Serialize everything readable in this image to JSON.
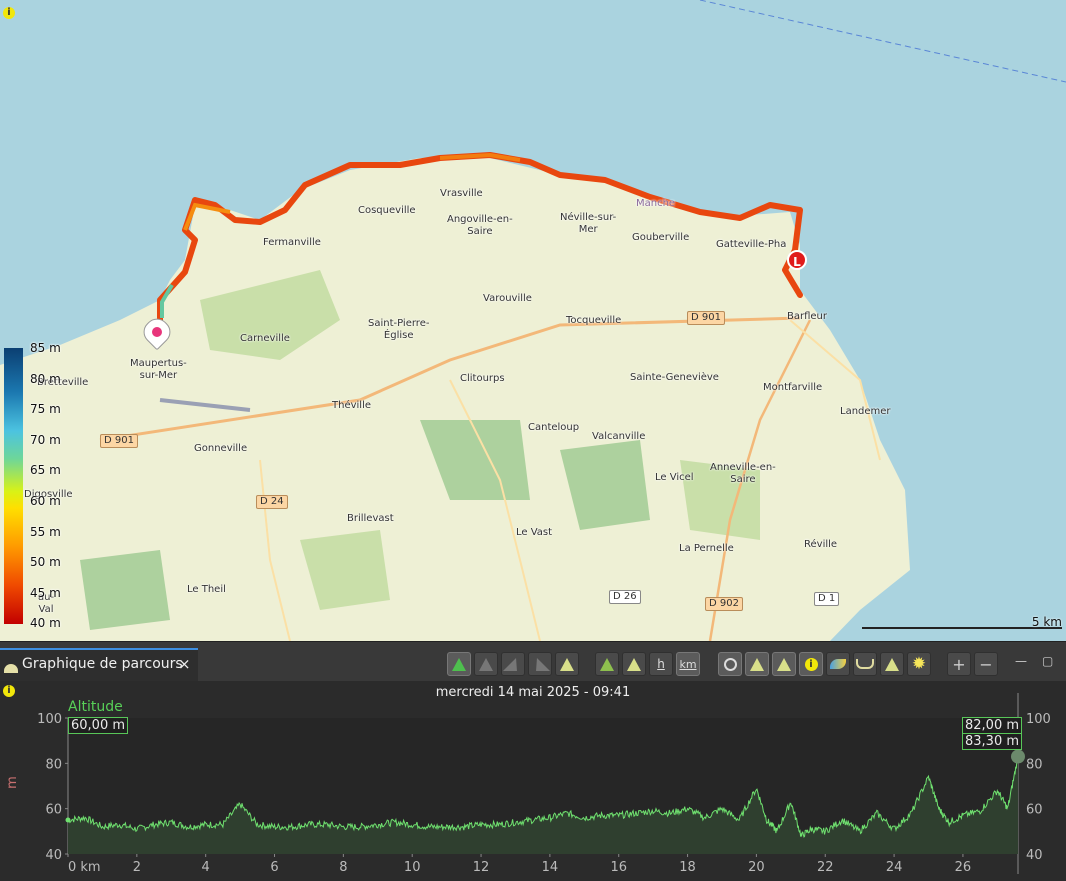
{
  "map": {
    "places": [
      {
        "name": "Vrasville"
      },
      {
        "name": "Cosqueville"
      },
      {
        "name": "Angoville-en-\nSaire"
      },
      {
        "name": "Néville-sur-\nMer"
      },
      {
        "name": "Gouberville"
      },
      {
        "name": "Gatteville-Pha"
      },
      {
        "name": "Fermanville"
      },
      {
        "name": "Varouville"
      },
      {
        "name": "Saint-Pierre-\nÉglise"
      },
      {
        "name": "Tocqueville"
      },
      {
        "name": "Barfleur"
      },
      {
        "name": "Carneville"
      },
      {
        "name": "Maupertus-\nsur-Mer"
      },
      {
        "name": "Bretteville"
      },
      {
        "name": "Clitourps"
      },
      {
        "name": "Sainte-Geneviève"
      },
      {
        "name": "Montfarville"
      },
      {
        "name": "Landemer"
      },
      {
        "name": "Théville"
      },
      {
        "name": "Canteloup"
      },
      {
        "name": "Valcanville"
      },
      {
        "name": "Gonneville"
      },
      {
        "name": "Le Vicel"
      },
      {
        "name": "Anneville-en-\nSaire"
      },
      {
        "name": "Brillevast"
      },
      {
        "name": "Le Vast"
      },
      {
        "name": "La Pernelle"
      },
      {
        "name": "Réville"
      },
      {
        "name": "Le Theil"
      },
      {
        "name": "Digosville"
      },
      {
        "name": "Manche"
      },
      {
        "name": "au-\nVal"
      }
    ],
    "roads": [
      "D 901",
      "D 901",
      "D 24",
      "D 26",
      "D 902",
      "D 1"
    ],
    "end_marker": "L",
    "scale_label": "5 km",
    "info_icon": "i",
    "legend": {
      "unit": "m",
      "labels": [
        "85",
        "80",
        "75",
        "70",
        "65",
        "60",
        "55",
        "50",
        "45",
        "40"
      ],
      "unit_labels": [
        "m",
        "m",
        "m",
        "m",
        "m",
        "m",
        "m",
        "m",
        "m",
        "m"
      ]
    }
  },
  "panel": {
    "tab_label": "Graphique de parcours",
    "close_glyph": "×",
    "toolbar_text": {
      "h": "h",
      "km": "km",
      "info": "i",
      "plus": "+",
      "minus": "−",
      "minimize": "—",
      "maximize": "▢"
    }
  },
  "chart_data": {
    "type": "area",
    "title": "mercredi 14 mai 2025 - 09:41",
    "series": [
      {
        "name": "Altitude"
      }
    ],
    "ylabel": "m",
    "xlabel": "",
    "x_tick_labels": [
      "0 km",
      "2",
      "4",
      "6",
      "8",
      "10",
      "12",
      "14",
      "16",
      "18",
      "20",
      "22",
      "24",
      "26"
    ],
    "y_tick_labels_left": [
      "100",
      "80",
      "60",
      "40"
    ],
    "y_tick_labels_right": [
      "100",
      "80",
      "60",
      "40"
    ],
    "ylim": [
      40,
      100
    ],
    "xlim": [
      0,
      27.6
    ],
    "start_value_label": "60,00 m",
    "end_value_labels": [
      "82,00 m",
      "83,30 m"
    ],
    "x_km": [
      0,
      0.5,
      1,
      1.5,
      2,
      2.5,
      3,
      3.5,
      4,
      4.5,
      5,
      5.5,
      6,
      6.5,
      7,
      7.5,
      8,
      8.5,
      9,
      9.5,
      10,
      10.5,
      11,
      11.5,
      12,
      12.5,
      13,
      13.5,
      14,
      14.5,
      15,
      15.5,
      16,
      16.5,
      17,
      17.5,
      18,
      18.5,
      19,
      19.5,
      20,
      20.3,
      20.6,
      21,
      21.3,
      21.6,
      22,
      22.5,
      23,
      23.5,
      24,
      24.5,
      25,
      25.3,
      25.6,
      26,
      26.5,
      27,
      27.3,
      27.6
    ],
    "altitude_m": [
      55,
      56,
      52,
      53,
      51,
      53,
      54,
      52,
      53,
      53,
      62,
      53,
      52,
      52,
      53,
      53,
      52,
      52,
      53,
      54,
      53,
      52,
      52,
      52,
      53,
      53,
      54,
      55,
      56,
      58,
      56,
      57,
      57,
      58,
      59,
      58,
      60,
      56,
      60,
      55,
      69,
      55,
      50,
      63,
      48,
      51,
      50,
      55,
      50,
      58,
      51,
      58,
      74,
      60,
      54,
      57,
      59,
      68,
      60,
      83
    ]
  }
}
